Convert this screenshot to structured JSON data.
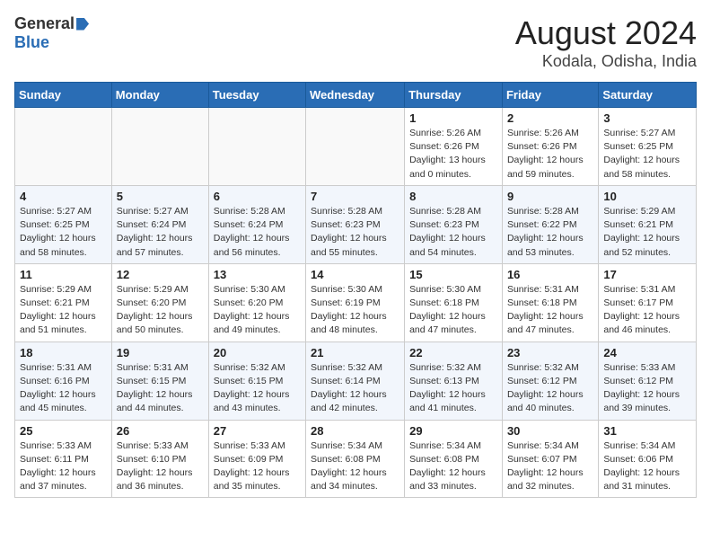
{
  "header": {
    "logo_general": "General",
    "logo_blue": "Blue",
    "month_year": "August 2024",
    "location": "Kodala, Odisha, India"
  },
  "weekdays": [
    "Sunday",
    "Monday",
    "Tuesday",
    "Wednesday",
    "Thursday",
    "Friday",
    "Saturday"
  ],
  "weeks": [
    [
      {
        "day": "",
        "info": ""
      },
      {
        "day": "",
        "info": ""
      },
      {
        "day": "",
        "info": ""
      },
      {
        "day": "",
        "info": ""
      },
      {
        "day": "1",
        "info": "Sunrise: 5:26 AM\nSunset: 6:26 PM\nDaylight: 13 hours\nand 0 minutes."
      },
      {
        "day": "2",
        "info": "Sunrise: 5:26 AM\nSunset: 6:26 PM\nDaylight: 12 hours\nand 59 minutes."
      },
      {
        "day": "3",
        "info": "Sunrise: 5:27 AM\nSunset: 6:25 PM\nDaylight: 12 hours\nand 58 minutes."
      }
    ],
    [
      {
        "day": "4",
        "info": "Sunrise: 5:27 AM\nSunset: 6:25 PM\nDaylight: 12 hours\nand 58 minutes."
      },
      {
        "day": "5",
        "info": "Sunrise: 5:27 AM\nSunset: 6:24 PM\nDaylight: 12 hours\nand 57 minutes."
      },
      {
        "day": "6",
        "info": "Sunrise: 5:28 AM\nSunset: 6:24 PM\nDaylight: 12 hours\nand 56 minutes."
      },
      {
        "day": "7",
        "info": "Sunrise: 5:28 AM\nSunset: 6:23 PM\nDaylight: 12 hours\nand 55 minutes."
      },
      {
        "day": "8",
        "info": "Sunrise: 5:28 AM\nSunset: 6:23 PM\nDaylight: 12 hours\nand 54 minutes."
      },
      {
        "day": "9",
        "info": "Sunrise: 5:28 AM\nSunset: 6:22 PM\nDaylight: 12 hours\nand 53 minutes."
      },
      {
        "day": "10",
        "info": "Sunrise: 5:29 AM\nSunset: 6:21 PM\nDaylight: 12 hours\nand 52 minutes."
      }
    ],
    [
      {
        "day": "11",
        "info": "Sunrise: 5:29 AM\nSunset: 6:21 PM\nDaylight: 12 hours\nand 51 minutes."
      },
      {
        "day": "12",
        "info": "Sunrise: 5:29 AM\nSunset: 6:20 PM\nDaylight: 12 hours\nand 50 minutes."
      },
      {
        "day": "13",
        "info": "Sunrise: 5:30 AM\nSunset: 6:20 PM\nDaylight: 12 hours\nand 49 minutes."
      },
      {
        "day": "14",
        "info": "Sunrise: 5:30 AM\nSunset: 6:19 PM\nDaylight: 12 hours\nand 48 minutes."
      },
      {
        "day": "15",
        "info": "Sunrise: 5:30 AM\nSunset: 6:18 PM\nDaylight: 12 hours\nand 47 minutes."
      },
      {
        "day": "16",
        "info": "Sunrise: 5:31 AM\nSunset: 6:18 PM\nDaylight: 12 hours\nand 47 minutes."
      },
      {
        "day": "17",
        "info": "Sunrise: 5:31 AM\nSunset: 6:17 PM\nDaylight: 12 hours\nand 46 minutes."
      }
    ],
    [
      {
        "day": "18",
        "info": "Sunrise: 5:31 AM\nSunset: 6:16 PM\nDaylight: 12 hours\nand 45 minutes."
      },
      {
        "day": "19",
        "info": "Sunrise: 5:31 AM\nSunset: 6:15 PM\nDaylight: 12 hours\nand 44 minutes."
      },
      {
        "day": "20",
        "info": "Sunrise: 5:32 AM\nSunset: 6:15 PM\nDaylight: 12 hours\nand 43 minutes."
      },
      {
        "day": "21",
        "info": "Sunrise: 5:32 AM\nSunset: 6:14 PM\nDaylight: 12 hours\nand 42 minutes."
      },
      {
        "day": "22",
        "info": "Sunrise: 5:32 AM\nSunset: 6:13 PM\nDaylight: 12 hours\nand 41 minutes."
      },
      {
        "day": "23",
        "info": "Sunrise: 5:32 AM\nSunset: 6:12 PM\nDaylight: 12 hours\nand 40 minutes."
      },
      {
        "day": "24",
        "info": "Sunrise: 5:33 AM\nSunset: 6:12 PM\nDaylight: 12 hours\nand 39 minutes."
      }
    ],
    [
      {
        "day": "25",
        "info": "Sunrise: 5:33 AM\nSunset: 6:11 PM\nDaylight: 12 hours\nand 37 minutes."
      },
      {
        "day": "26",
        "info": "Sunrise: 5:33 AM\nSunset: 6:10 PM\nDaylight: 12 hours\nand 36 minutes."
      },
      {
        "day": "27",
        "info": "Sunrise: 5:33 AM\nSunset: 6:09 PM\nDaylight: 12 hours\nand 35 minutes."
      },
      {
        "day": "28",
        "info": "Sunrise: 5:34 AM\nSunset: 6:08 PM\nDaylight: 12 hours\nand 34 minutes."
      },
      {
        "day": "29",
        "info": "Sunrise: 5:34 AM\nSunset: 6:08 PM\nDaylight: 12 hours\nand 33 minutes."
      },
      {
        "day": "30",
        "info": "Sunrise: 5:34 AM\nSunset: 6:07 PM\nDaylight: 12 hours\nand 32 minutes."
      },
      {
        "day": "31",
        "info": "Sunrise: 5:34 AM\nSunset: 6:06 PM\nDaylight: 12 hours\nand 31 minutes."
      }
    ]
  ]
}
